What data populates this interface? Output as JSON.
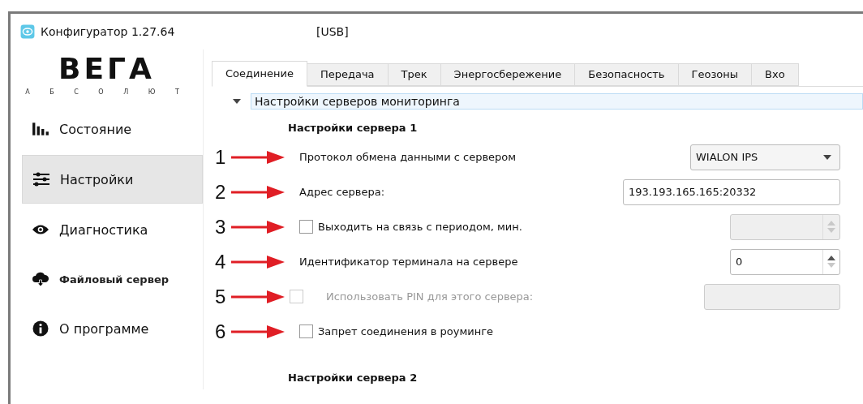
{
  "window": {
    "title": "Конфигуратор 1.27.64",
    "connection": "[USB]"
  },
  "logo": {
    "wordmark": "ВЕГА",
    "tagline": "А Б С О Л Ю Т"
  },
  "sidebar": {
    "items": [
      {
        "label": "Состояние",
        "kind": "bars",
        "selected": false
      },
      {
        "label": "Настройки",
        "kind": "sliders",
        "selected": true
      },
      {
        "label": "Диагностика",
        "kind": "eye",
        "selected": false
      },
      {
        "label": "Файловый сервер",
        "kind": "cloud",
        "selected": false
      },
      {
        "label": "О программе",
        "kind": "info",
        "selected": false
      }
    ]
  },
  "tabs": [
    {
      "label": "Соединение",
      "selected": true
    },
    {
      "label": "Передача",
      "selected": false
    },
    {
      "label": "Трек",
      "selected": false
    },
    {
      "label": "Энергосбережение",
      "selected": false
    },
    {
      "label": "Безопасность",
      "selected": false
    },
    {
      "label": "Геозоны",
      "selected": false
    },
    {
      "label": "Вхо",
      "selected": false
    }
  ],
  "section": {
    "title": "Настройки серверов мониторинга",
    "expanded": true
  },
  "groups": [
    {
      "title": "Настройки сервера 1",
      "rows": [
        {
          "marker": "1",
          "label": "Протокол обмена данными с сервером",
          "disabled": false,
          "control": {
            "kind": "select",
            "value": "WIALON IPS"
          }
        },
        {
          "marker": "2",
          "label": "Адрес сервера:",
          "disabled": false,
          "control": {
            "kind": "text",
            "value": "193.193.165.165:20332",
            "disabled": false
          }
        },
        {
          "marker": "3",
          "label": "Выходить на связь с периодом, мин.",
          "disabled": false,
          "checkbox": {
            "checked": false,
            "disabled": false
          },
          "control": {
            "kind": "spin",
            "disabled": true
          }
        },
        {
          "marker": "4",
          "label": "Идентификатор терминала на сервере",
          "disabled": false,
          "control": {
            "kind": "spin",
            "value": "0",
            "disabled": false
          }
        },
        {
          "marker": "5",
          "label": "Использовать PIN для этого сервера:",
          "disabled": true,
          "checkbox": {
            "checked": false,
            "disabled": true
          },
          "control": {
            "kind": "pin",
            "disabled": true
          }
        },
        {
          "marker": "6",
          "label": "Запрет соединения в роуминге",
          "disabled": false,
          "checkbox": {
            "checked": false,
            "disabled": false
          }
        }
      ]
    },
    {
      "title": "Настройки сервера 2"
    }
  ]
}
